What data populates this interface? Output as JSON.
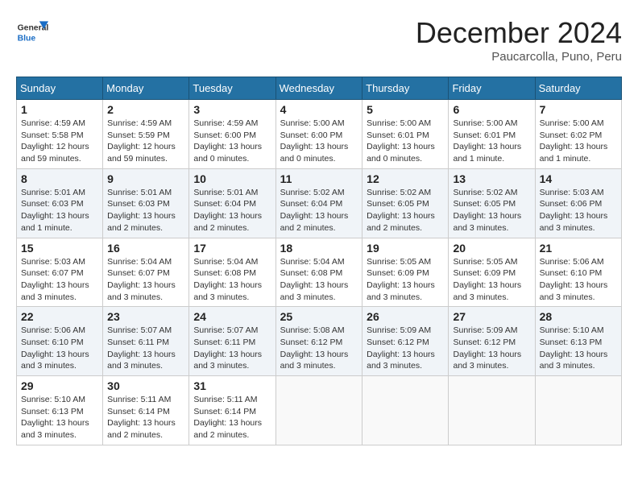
{
  "header": {
    "logo_general": "General",
    "logo_blue": "Blue",
    "title": "December 2024",
    "subtitle": "Paucarcolla, Puno, Peru"
  },
  "calendar": {
    "days_of_week": [
      "Sunday",
      "Monday",
      "Tuesday",
      "Wednesday",
      "Thursday",
      "Friday",
      "Saturday"
    ],
    "weeks": [
      [
        null,
        {
          "day": "2",
          "sunrise": "4:59 AM",
          "sunset": "5:59 PM",
          "daylight": "12 hours and 59 minutes."
        },
        {
          "day": "3",
          "sunrise": "4:59 AM",
          "sunset": "6:00 PM",
          "daylight": "13 hours and 0 minutes."
        },
        {
          "day": "4",
          "sunrise": "5:00 AM",
          "sunset": "6:00 PM",
          "daylight": "13 hours and 0 minutes."
        },
        {
          "day": "5",
          "sunrise": "5:00 AM",
          "sunset": "6:01 PM",
          "daylight": "13 hours and 0 minutes."
        },
        {
          "day": "6",
          "sunrise": "5:00 AM",
          "sunset": "6:01 PM",
          "daylight": "13 hours and 1 minute."
        },
        {
          "day": "7",
          "sunrise": "5:00 AM",
          "sunset": "6:02 PM",
          "daylight": "13 hours and 1 minute."
        }
      ],
      [
        {
          "day": "1",
          "sunrise": "4:59 AM",
          "sunset": "5:58 PM",
          "daylight": "12 hours and 59 minutes."
        },
        {
          "day": "9",
          "sunrise": "5:01 AM",
          "sunset": "6:03 PM",
          "daylight": "13 hours and 2 minutes."
        },
        {
          "day": "10",
          "sunrise": "5:01 AM",
          "sunset": "6:04 PM",
          "daylight": "13 hours and 2 minutes."
        },
        {
          "day": "11",
          "sunrise": "5:02 AM",
          "sunset": "6:04 PM",
          "daylight": "13 hours and 2 minutes."
        },
        {
          "day": "12",
          "sunrise": "5:02 AM",
          "sunset": "6:05 PM",
          "daylight": "13 hours and 2 minutes."
        },
        {
          "day": "13",
          "sunrise": "5:02 AM",
          "sunset": "6:05 PM",
          "daylight": "13 hours and 3 minutes."
        },
        {
          "day": "14",
          "sunrise": "5:03 AM",
          "sunset": "6:06 PM",
          "daylight": "13 hours and 3 minutes."
        }
      ],
      [
        {
          "day": "8",
          "sunrise": "5:01 AM",
          "sunset": "6:03 PM",
          "daylight": "13 hours and 1 minute."
        },
        {
          "day": "16",
          "sunrise": "5:04 AM",
          "sunset": "6:07 PM",
          "daylight": "13 hours and 3 minutes."
        },
        {
          "day": "17",
          "sunrise": "5:04 AM",
          "sunset": "6:08 PM",
          "daylight": "13 hours and 3 minutes."
        },
        {
          "day": "18",
          "sunrise": "5:04 AM",
          "sunset": "6:08 PM",
          "daylight": "13 hours and 3 minutes."
        },
        {
          "day": "19",
          "sunrise": "5:05 AM",
          "sunset": "6:09 PM",
          "daylight": "13 hours and 3 minutes."
        },
        {
          "day": "20",
          "sunrise": "5:05 AM",
          "sunset": "6:09 PM",
          "daylight": "13 hours and 3 minutes."
        },
        {
          "day": "21",
          "sunrise": "5:06 AM",
          "sunset": "6:10 PM",
          "daylight": "13 hours and 3 minutes."
        }
      ],
      [
        {
          "day": "15",
          "sunrise": "5:03 AM",
          "sunset": "6:07 PM",
          "daylight": "13 hours and 3 minutes."
        },
        {
          "day": "23",
          "sunrise": "5:07 AM",
          "sunset": "6:11 PM",
          "daylight": "13 hours and 3 minutes."
        },
        {
          "day": "24",
          "sunrise": "5:07 AM",
          "sunset": "6:11 PM",
          "daylight": "13 hours and 3 minutes."
        },
        {
          "day": "25",
          "sunrise": "5:08 AM",
          "sunset": "6:12 PM",
          "daylight": "13 hours and 3 minutes."
        },
        {
          "day": "26",
          "sunrise": "5:09 AM",
          "sunset": "6:12 PM",
          "daylight": "13 hours and 3 minutes."
        },
        {
          "day": "27",
          "sunrise": "5:09 AM",
          "sunset": "6:12 PM",
          "daylight": "13 hours and 3 minutes."
        },
        {
          "day": "28",
          "sunrise": "5:10 AM",
          "sunset": "6:13 PM",
          "daylight": "13 hours and 3 minutes."
        }
      ],
      [
        {
          "day": "22",
          "sunrise": "5:06 AM",
          "sunset": "6:10 PM",
          "daylight": "13 hours and 3 minutes."
        },
        {
          "day": "30",
          "sunrise": "5:11 AM",
          "sunset": "6:14 PM",
          "daylight": "13 hours and 2 minutes."
        },
        {
          "day": "31",
          "sunrise": "5:11 AM",
          "sunset": "6:14 PM",
          "daylight": "13 hours and 2 minutes."
        },
        null,
        null,
        null,
        null
      ],
      [
        {
          "day": "29",
          "sunrise": "5:10 AM",
          "sunset": "6:13 PM",
          "daylight": "13 hours and 3 minutes."
        },
        null,
        null,
        null,
        null,
        null,
        null
      ]
    ]
  }
}
